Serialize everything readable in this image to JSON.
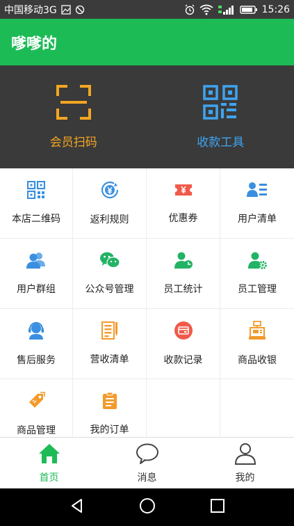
{
  "status": {
    "carrier": "中国移动3G",
    "time": "15:26"
  },
  "app": {
    "title": "嗲嗲的"
  },
  "hero": [
    {
      "label": "会员扫码",
      "icon": "scan-icon",
      "color": "#f4a622"
    },
    {
      "label": "收款工具",
      "icon": "qr-code-icon",
      "color": "#3fa4f0"
    }
  ],
  "grid": [
    {
      "label": "本店二维码",
      "icon": "qr-code-icon",
      "color": "#3a8fe0"
    },
    {
      "label": "返利规则",
      "icon": "rebate-icon",
      "color": "#3a8fe0"
    },
    {
      "label": "优惠券",
      "icon": "coupon-icon",
      "color": "#f05a4a"
    },
    {
      "label": "用户清单",
      "icon": "user-list-icon",
      "color": "#3a8fe0"
    },
    {
      "label": "用户群组",
      "icon": "user-group-icon",
      "color": "#3a8fe0"
    },
    {
      "label": "公众号管理",
      "icon": "wechat-icon",
      "color": "#22b365"
    },
    {
      "label": "员工统计",
      "icon": "staff-stats-icon",
      "color": "#22b365"
    },
    {
      "label": "员工管理",
      "icon": "staff-manage-icon",
      "color": "#22b365"
    },
    {
      "label": "售后服务",
      "icon": "customer-service-icon",
      "color": "#3a8fe0"
    },
    {
      "label": "营收清单",
      "icon": "revenue-list-icon",
      "color": "#f39a2b"
    },
    {
      "label": "收款记录",
      "icon": "payment-record-icon",
      "color": "#f05a4a"
    },
    {
      "label": "商品收银",
      "icon": "cashier-icon",
      "color": "#f39a2b"
    },
    {
      "label": "商品管理",
      "icon": "product-tag-icon",
      "color": "#f39a2b"
    },
    {
      "label": "我的订单",
      "icon": "order-icon",
      "color": "#f39a2b"
    }
  ],
  "tabs": [
    {
      "label": "首页",
      "icon": "home-icon"
    },
    {
      "label": "消息",
      "icon": "message-icon"
    },
    {
      "label": "我的",
      "icon": "profile-icon"
    }
  ],
  "theme": {
    "primary": "#1dbb56",
    "dark": "#3a3a3a"
  }
}
